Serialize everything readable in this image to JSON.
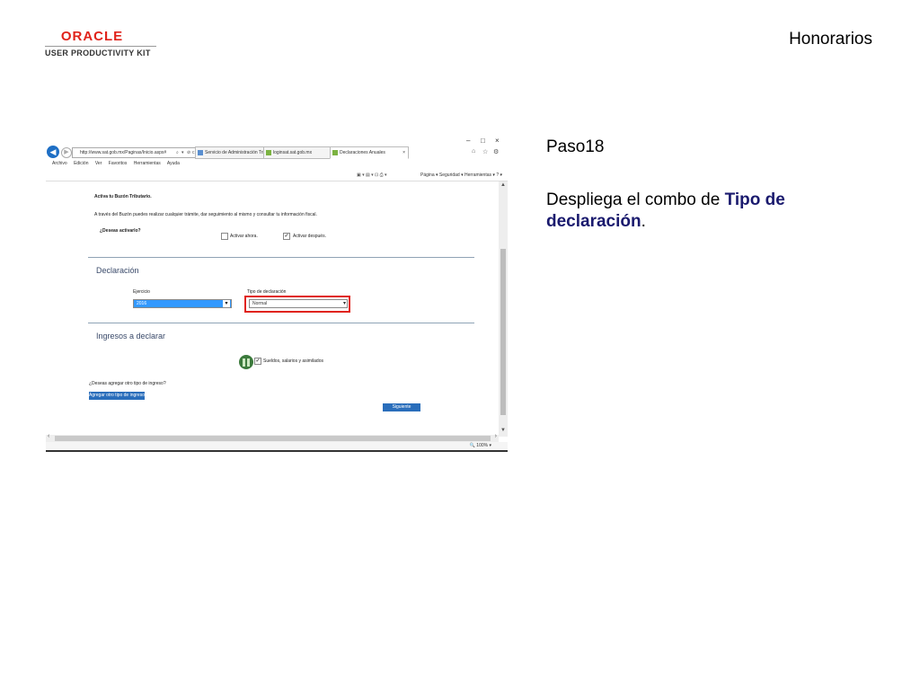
{
  "header": {
    "logo_brand": "ORACLE",
    "logo_subtitle": "USER PRODUCTIVITY KIT",
    "title": "Honorarios"
  },
  "step": {
    "label": "Paso18",
    "instruction_prefix": "Despliega el combo de ",
    "instruction_highlight": "Tipo de declaración",
    "instruction_suffix": "."
  },
  "browser": {
    "window_controls": [
      "–",
      "□",
      "×"
    ],
    "address": "http://www.sat.gob.mx/Paginas/Inicio.aspx#",
    "address_controls": [
      "⌕",
      "▾",
      "⊘",
      "c"
    ],
    "tabs": [
      {
        "label": "Servicio de Administración Tri...",
        "active": false
      },
      {
        "label": "loginsat.sat.gob.mx",
        "active": false
      },
      {
        "label": "Declaraciones Anuales",
        "active": true
      }
    ],
    "toolbar_icons": [
      "home-icon",
      "star-icon",
      "gear-icon"
    ],
    "menu": [
      "Archivo",
      "Edición",
      "Ver",
      "Favoritos",
      "Herramientas",
      "Ayuda"
    ],
    "commands": [
      "Página ▾",
      "Seguridad ▾",
      "Herramientas ▾",
      "? ▾"
    ],
    "zoom": "100%"
  },
  "form": {
    "buzon_title": "Activa tu Buzón Tributario.",
    "buzon_text": "A través del Buzón puedes realizar cualquier trámite, dar seguimiento al mismo y consultar tu información fiscal.",
    "buzon_question": "¿Deseas activarlo?",
    "activar_ahora": {
      "label": "Activar ahora.",
      "checked": false
    },
    "activar_despues": {
      "label": "Activar después.",
      "checked": true
    },
    "declaracion_section": "Declaración",
    "ejercicio_label": "Ejercicio",
    "ejercicio_value": "2016",
    "tipo_label": "Tipo de declaración",
    "tipo_value": "Normal",
    "ingresos_section": "Ingresos a declarar",
    "ingreso_item": {
      "label": "Sueldos, salarios y asimilados",
      "checked": true
    },
    "otro_question": "¿Deseas agregar otro tipo de ingreso?",
    "agregar_button": "Agregar otro tipo de ingreso",
    "siguiente_button": "Siguiente"
  },
  "colors": {
    "highlight_box": "#e0231b",
    "instruction_highlight": "#1a1a6e",
    "button_blue": "#2a6ebb",
    "oracle_red": "#e0231b"
  }
}
